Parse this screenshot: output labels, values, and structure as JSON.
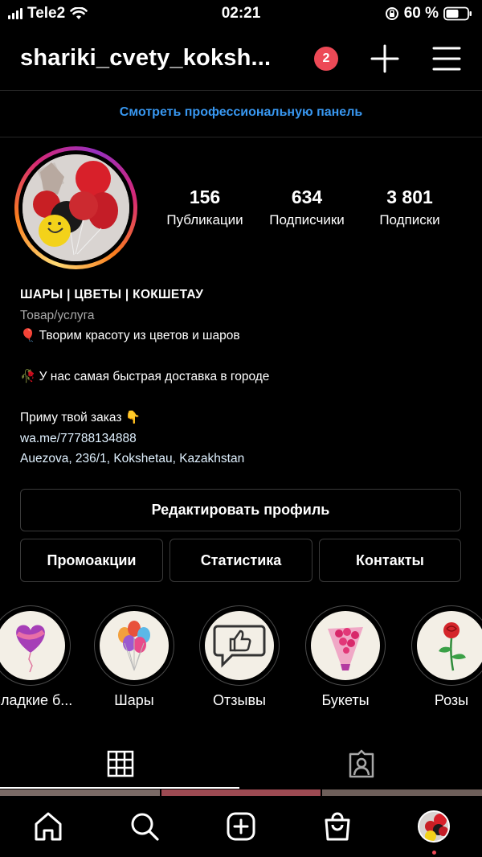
{
  "status_bar": {
    "carrier": "Tele2",
    "time": "02:21",
    "battery": "60 %",
    "battery_level": 0.6
  },
  "header": {
    "username": "shariki_cvety_koksh...",
    "notification_count": "2"
  },
  "pro_panel_link": "Смотреть профессиональную панель",
  "stats": [
    {
      "value": "156",
      "label": "Публикации"
    },
    {
      "value": "634",
      "label": "Подписчики"
    },
    {
      "value": "3 801",
      "label": "Подписки"
    }
  ],
  "bio": {
    "name": "ШАРЫ | ЦВЕТЫ | КОКШЕТАУ",
    "category": "Товар/услуга",
    "line1": "🎈 Творим красоту из цветов и шаров",
    "line2": "🥀 У нас самая быстрая доставка в городе",
    "line3": "Приму твой заказ 👇",
    "link": "wa.me/77788134888",
    "address": "Auezova, 236/1, Kokshetau, Kazakhstan"
  },
  "buttons": {
    "edit_profile": "Редактировать профиль",
    "promotions": "Промоакции",
    "insights": "Статистика",
    "contacts": "Контакты"
  },
  "highlights": [
    {
      "label": "Сладкие б...",
      "icon": "heart-balloon-icon"
    },
    {
      "label": "Шары",
      "icon": "balloons-icon"
    },
    {
      "label": "Отзывы",
      "icon": "thumbs-up-icon"
    },
    {
      "label": "Букеты",
      "icon": "bouquet-icon"
    },
    {
      "label": "Розы",
      "icon": "rose-icon"
    }
  ],
  "colors": {
    "accent_link": "#3897f0",
    "badge": "#ed4956",
    "background": "#000000"
  }
}
